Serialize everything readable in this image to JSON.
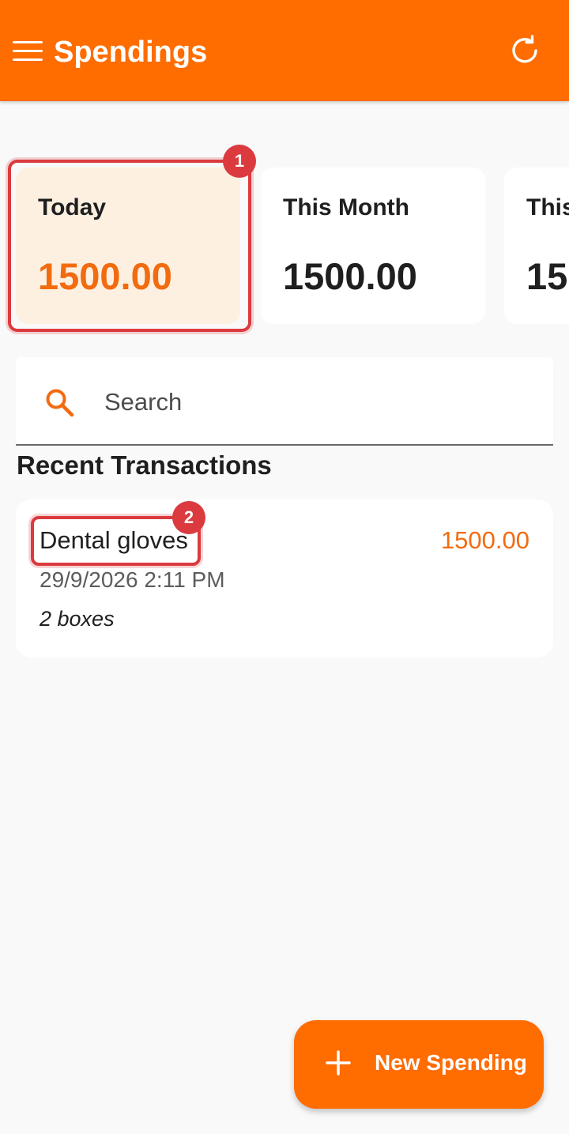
{
  "app_bar": {
    "title": "Spendings",
    "menu_icon": "hamburger-menu-icon",
    "refresh_icon": "refresh-icon",
    "color": "#ff6c00"
  },
  "summary_cards": [
    {
      "label": "Today",
      "value": "1500.00",
      "selected": true
    },
    {
      "label": "This Month",
      "value": "1500.00",
      "selected": false
    },
    {
      "label": "This",
      "value": "15",
      "selected": false
    }
  ],
  "annotations": [
    "1",
    "2"
  ],
  "search": {
    "placeholder": "Search",
    "icon": "search-icon",
    "value": ""
  },
  "section_title": "Recent Transactions",
  "transactions": [
    {
      "title": "Dental gloves",
      "amount": "1500.00",
      "date": "29/9/2026 2:11 PM",
      "note": "2 boxes"
    }
  ],
  "fab": {
    "label": "New Spending",
    "icon": "plus-icon"
  },
  "colors": {
    "accent": "#ff6c00",
    "amount": "#f26b0f",
    "selected_card_bg": "#fdf0e1",
    "annotation": "#db3a3e",
    "background": "#f9f9f9"
  }
}
